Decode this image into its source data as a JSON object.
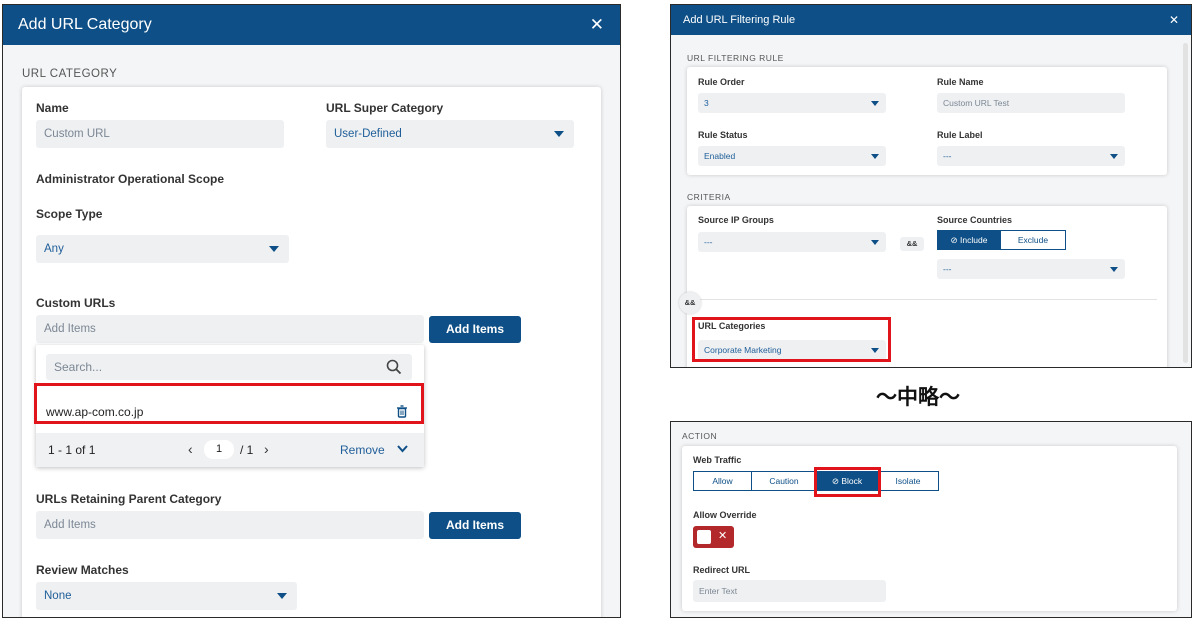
{
  "left_dialog": {
    "title": "Add URL Category",
    "close_icon": "close-icon",
    "section": "URL CATEGORY",
    "name_label": "Name",
    "name_value": "Custom URL",
    "super_category_label": "URL Super Category",
    "super_category_value": "User-Defined",
    "admin_scope_label": "Administrator Operational Scope",
    "scope_type_label": "Scope Type",
    "scope_type_value": "Any",
    "custom_urls_label": "Custom URLs",
    "custom_urls_placeholder": "Add Items",
    "add_items_button": "Add Items",
    "dropdown": {
      "search_placeholder": "Search...",
      "search_icon": "search-icon",
      "items": [
        "www.ap-com.co.jp"
      ],
      "delete_icon": "trash-icon",
      "range": "1 - 1 of 1",
      "current_page": "1",
      "total_pages": "/ 1",
      "remove_label": "Remove"
    },
    "retaining_label": "URLs Retaining Parent Category",
    "retaining_placeholder": "Add Items",
    "retaining_button": "Add Items",
    "review_label": "Review Matches",
    "review_value": "None"
  },
  "right_top_dialog": {
    "title": "Add URL Filtering Rule",
    "section_rule": "URL FILTERING RULE",
    "rule_order_label": "Rule Order",
    "rule_order_value": "3",
    "rule_name_label": "Rule Name",
    "rule_name_value": "Custom URL Test",
    "rule_status_label": "Rule Status",
    "rule_status_value": "Enabled",
    "rule_label_label": "Rule Label",
    "rule_label_value": "---",
    "section_criteria": "CRITERIA",
    "source_ip_label": "Source IP Groups",
    "source_ip_value": "---",
    "and_operator": "&&",
    "source_countries_label": "Source Countries",
    "include_label": "Include",
    "exclude_label": "Exclude",
    "countries_value": "---",
    "url_categories_label": "URL Categories",
    "url_categories_value": "Corporate Marketing"
  },
  "omission_text": "～中略～",
  "right_bottom_dialog": {
    "section_action": "ACTION",
    "web_traffic_label": "Web Traffic",
    "actions": [
      "Allow",
      "Caution",
      "Block",
      "Isolate"
    ],
    "selected_action": "Block",
    "allow_override_label": "Allow Override",
    "redirect_label": "Redirect URL",
    "redirect_placeholder": "Enter Text"
  },
  "colors": {
    "brand": "#0d4f86",
    "highlight": "#e0141a",
    "toggle_off": "#b3292b"
  }
}
